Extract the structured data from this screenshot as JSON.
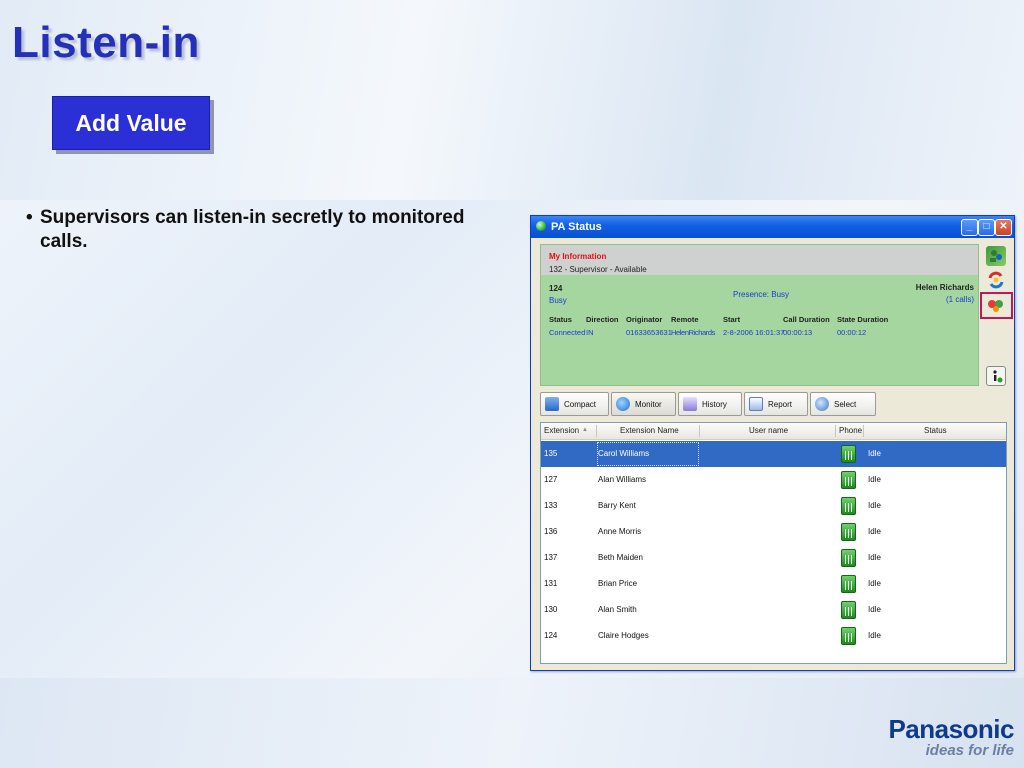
{
  "slide": {
    "title": "Listen-in",
    "badge": "Add Value",
    "bullet": "Supervisors can listen-in secretly to monitored calls."
  },
  "brand": {
    "name": "Panasonic",
    "tagline": "ideas for life"
  },
  "window": {
    "title": "PA Status",
    "controls": {
      "minimize": "_",
      "maximize": "□",
      "close": "✕"
    },
    "my_information": {
      "heading": "My Information",
      "line": "132 - Supervisor - Available",
      "extension": "124",
      "state": "Busy",
      "presence": "Presence:  Busy",
      "user": "Helen Richards",
      "calls": "(1 calls)",
      "columns": [
        "Status",
        "Direction",
        "Originator",
        "Remote",
        "Start",
        "Call Duration",
        "State Duration"
      ],
      "call": [
        "Connected",
        "IN",
        "01633653631",
        "HelenRichards",
        "2-8-2006 16:01:37",
        "00:00:13",
        "00:00:12"
      ]
    },
    "toolbar": [
      "Compact",
      "Monitor",
      "History",
      "Report",
      "Select"
    ],
    "table": {
      "headers": [
        "Extension",
        "Extension Name",
        "User name",
        "Phone",
        "Status"
      ],
      "sort_indicator": "▲",
      "rows": [
        {
          "ext": "135",
          "name": "Carol Williams",
          "status": "Idle"
        },
        {
          "ext": "127",
          "name": "Alan Williams",
          "status": "Idle"
        },
        {
          "ext": "133",
          "name": "Barry Kent",
          "status": "Idle"
        },
        {
          "ext": "136",
          "name": "Anne Morris",
          "status": "Idle"
        },
        {
          "ext": "137",
          "name": "Beth Maiden",
          "status": "Idle"
        },
        {
          "ext": "131",
          "name": "Brian Price",
          "status": "Idle"
        },
        {
          "ext": "130",
          "name": "Alan Smith",
          "status": "Idle"
        },
        {
          "ext": "124",
          "name": "Claire Hodges",
          "status": "Idle"
        }
      ]
    }
  },
  "colors": {
    "title": "#2430b8",
    "badge_bg": "#2a2fd6",
    "panel_green": "#a5d6a0",
    "selection": "#316ac5",
    "highlight": "#c2185b"
  }
}
